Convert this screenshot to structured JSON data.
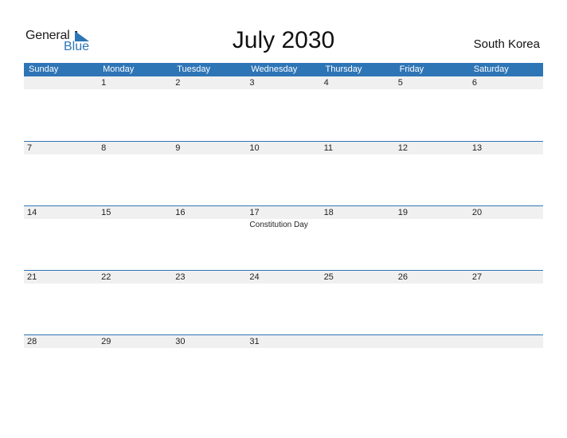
{
  "logo": {
    "line1": "General",
    "line2": "Blue"
  },
  "title": "July 2030",
  "country": "South Korea",
  "colors": {
    "accent": "#2e75b6",
    "band": "#f0f0f0"
  },
  "weekdays": [
    "Sunday",
    "Monday",
    "Tuesday",
    "Wednesday",
    "Thursday",
    "Friday",
    "Saturday"
  ],
  "weeks": [
    [
      {
        "day": ""
      },
      {
        "day": "1"
      },
      {
        "day": "2"
      },
      {
        "day": "3"
      },
      {
        "day": "4"
      },
      {
        "day": "5"
      },
      {
        "day": "6"
      }
    ],
    [
      {
        "day": "7"
      },
      {
        "day": "8"
      },
      {
        "day": "9"
      },
      {
        "day": "10"
      },
      {
        "day": "11"
      },
      {
        "day": "12"
      },
      {
        "day": "13"
      }
    ],
    [
      {
        "day": "14"
      },
      {
        "day": "15"
      },
      {
        "day": "16"
      },
      {
        "day": "17",
        "event": "Constitution Day"
      },
      {
        "day": "18"
      },
      {
        "day": "19"
      },
      {
        "day": "20"
      }
    ],
    [
      {
        "day": "21"
      },
      {
        "day": "22"
      },
      {
        "day": "23"
      },
      {
        "day": "24"
      },
      {
        "day": "25"
      },
      {
        "day": "26"
      },
      {
        "day": "27"
      }
    ],
    [
      {
        "day": "28"
      },
      {
        "day": "29"
      },
      {
        "day": "30"
      },
      {
        "day": "31"
      },
      {
        "day": ""
      },
      {
        "day": ""
      },
      {
        "day": ""
      }
    ]
  ]
}
